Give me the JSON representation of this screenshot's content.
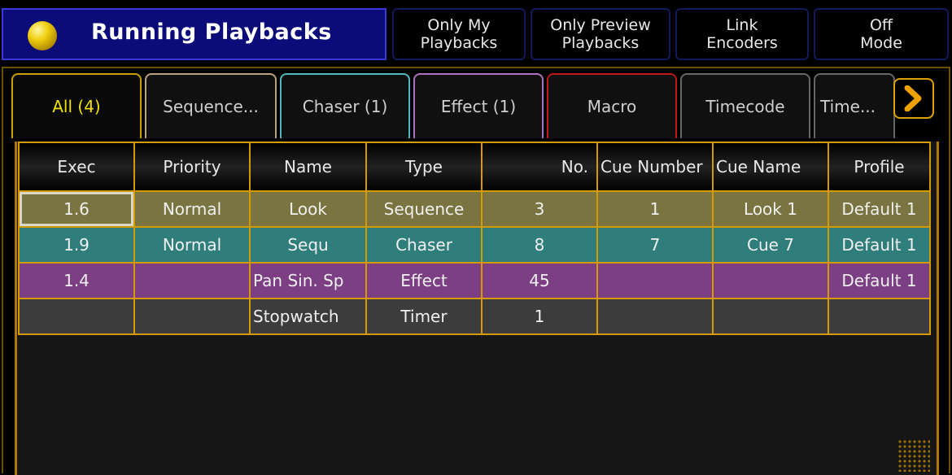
{
  "window": {
    "title": "Running Playbacks",
    "title_icon": "yellow-ball-icon"
  },
  "toolbar": [
    {
      "label": "Only My\nPlaybacks"
    },
    {
      "label": "Only Preview\nPlaybacks"
    },
    {
      "label": "Link\nEncoders"
    },
    {
      "label": "Off\nMode"
    }
  ],
  "tabs": [
    {
      "label": "All (4)",
      "color": "#c8a000"
    },
    {
      "label": "Sequence...",
      "color": "#bca27a"
    },
    {
      "label": "Chaser (1)",
      "color": "#4fb8c0"
    },
    {
      "label": "Effect (1)",
      "color": "#b070c0"
    },
    {
      "label": "Macro",
      "color": "#c01818"
    },
    {
      "label": "Timecode",
      "color": "#666666"
    },
    {
      "label": "Time...",
      "color": "#666666"
    }
  ],
  "scroll_icon": "chevron-right-icon",
  "table": {
    "columns": [
      "Exec",
      "Priority",
      "Name",
      "Type",
      "No.",
      "Cue Number",
      "Cue Name",
      "Profile"
    ],
    "rows": [
      {
        "kind": "sequence",
        "cells": [
          "1.6",
          "Normal",
          "Look",
          "Sequence",
          "3",
          "1",
          "Look 1",
          "Default 1"
        ]
      },
      {
        "kind": "chaser",
        "cells": [
          "1.9",
          "Normal",
          "Sequ",
          "Chaser",
          "8",
          "7",
          "Cue 7",
          "Default 1"
        ]
      },
      {
        "kind": "effect",
        "cells": [
          "1.4",
          "",
          "Pan Sin. Sp",
          "Effect",
          "45",
          "",
          "",
          "Default 1"
        ]
      },
      {
        "kind": "timer",
        "cells": [
          "",
          "",
          "Stopwatch",
          "Timer",
          "1",
          "",
          "",
          ""
        ]
      }
    ]
  },
  "colors": {
    "title_bg": "#0b0b7a",
    "accent": "#d49a00",
    "sequence_row": "#7a7440",
    "chaser_row": "#2f7e7c",
    "effect_row": "#7c3f84",
    "timer_row": "#3c3c3c"
  }
}
